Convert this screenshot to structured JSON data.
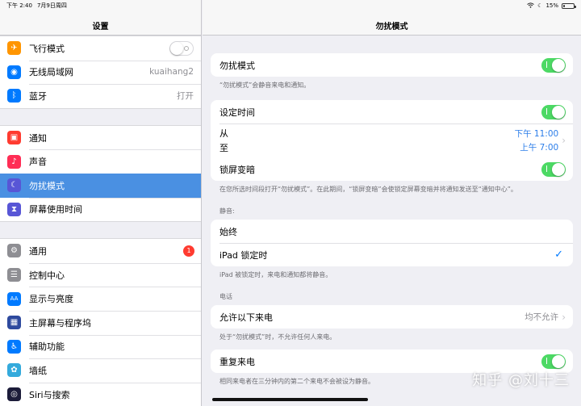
{
  "status_bar": {
    "time": "下午 2:40",
    "date": "7月9日周四",
    "battery": "15%",
    "battery_level": 0.15
  },
  "left": {
    "title": "设置",
    "groups": [
      [
        {
          "label": "飞行模式",
          "icon": "airplane-icon",
          "color": "#ff9500",
          "glyph": "✈",
          "toggle": "off"
        },
        {
          "label": "无线局域网",
          "icon": "wifi-icon",
          "color": "#007aff",
          "glyph": "◉",
          "value": "kuaihang2"
        },
        {
          "label": "蓝牙",
          "icon": "bluetooth-icon",
          "color": "#007aff",
          "glyph": "ᛒ",
          "value": "打开"
        }
      ],
      [
        {
          "label": "通知",
          "icon": "notifications-icon",
          "color": "#ff3b30",
          "glyph": "▣"
        },
        {
          "label": "声音",
          "icon": "sound-icon",
          "color": "#ff2d55",
          "glyph": "♪"
        },
        {
          "label": "勿扰模式",
          "icon": "moon-icon",
          "color": "#5856d6",
          "glyph": "☾",
          "selected": true
        },
        {
          "label": "屏幕使用时间",
          "icon": "hourglass-icon",
          "color": "#5856d6",
          "glyph": "⧗"
        }
      ],
      [
        {
          "label": "通用",
          "icon": "gear-icon",
          "color": "#8e8e93",
          "glyph": "⚙",
          "badge": "1"
        },
        {
          "label": "控制中心",
          "icon": "control-center-icon",
          "color": "#8e8e93",
          "glyph": "☰"
        },
        {
          "label": "显示与亮度",
          "icon": "display-icon",
          "color": "#007aff",
          "glyph": "AA"
        },
        {
          "label": "主屏幕与程序坞",
          "icon": "home-screen-icon",
          "color": "#2e4a9e",
          "glyph": "▦"
        },
        {
          "label": "辅助功能",
          "icon": "accessibility-icon",
          "color": "#007aff",
          "glyph": "♿"
        },
        {
          "label": "墙纸",
          "icon": "wallpaper-icon",
          "color": "#34aadc",
          "glyph": "✿"
        },
        {
          "label": "Siri与搜索",
          "icon": "siri-icon",
          "color": "#1c1c3a",
          "glyph": "◎"
        }
      ]
    ]
  },
  "right": {
    "title": "勿扰模式",
    "dnd": {
      "label": "勿扰模式",
      "footer": "“勿扰模式”会静音来电和通知。"
    },
    "schedule": {
      "label": "设定时间",
      "from_label": "从",
      "to_label": "至",
      "from_time": "下午 11:00",
      "to_time": "上午 7:00",
      "dim_label": "锁屏变暗",
      "footer": "在您所选时间段打开“勿扰模式”。在此期间，“锁屏变暗”会使锁定屏幕变暗并将通知发送至“通知中心”。"
    },
    "silence": {
      "section_title": "静音:",
      "always": "始终",
      "locked": "iPad 锁定时",
      "footer": "iPad 被锁定时，来电和通知都将静音。"
    },
    "phone": {
      "section_title": "电话",
      "allow_calls": "允许以下来电",
      "allow_value": "均不允许",
      "footer": "处于“勿扰模式”时，不允许任何人来电。"
    },
    "repeat": {
      "label": "重复来电",
      "footer": "相同来电者在三分钟内的第二个来电不会被设为静音。"
    }
  },
  "watermark": "知乎 @刘十三"
}
